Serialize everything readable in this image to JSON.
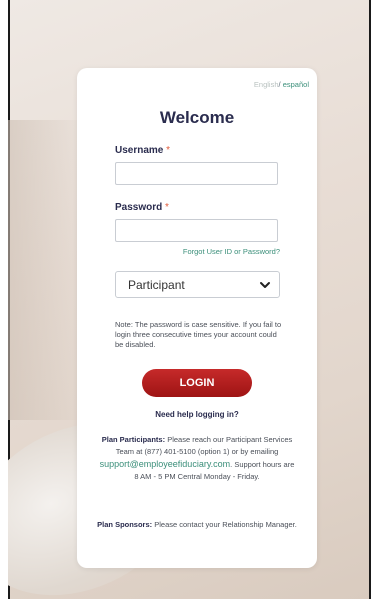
{
  "lang": {
    "english": "English",
    "separator": "/",
    "spanish": "español"
  },
  "title": "Welcome",
  "username": {
    "label": "Username",
    "required_mark": "*",
    "value": ""
  },
  "password": {
    "label": "Password",
    "required_mark": "*",
    "value": ""
  },
  "forgot_link": "Forgot User ID or Password?",
  "role_select": {
    "selected": "Participant"
  },
  "note": "Note: The password is case sensitive. If you fail to login three consecutive times your account could be disabled.",
  "login_button": "LOGIN",
  "help_heading": "Need help logging in?",
  "participants": {
    "heading": "Plan Participants:",
    "text_before": "Please reach our Participant Services Team at (877) 401-5100 (option 1) or by emailing",
    "email": "support@employeefiduciary.com",
    "text_after": ". Support hours are 8 AM - 5 PM Central Monday - Friday."
  },
  "sponsors": {
    "heading": "Plan Sponsors:",
    "text": "Please contact your Relationship Manager."
  },
  "colors": {
    "accent_red": "#b01e1e",
    "link_green": "#3b8f7a",
    "heading_navy": "#2a2c4e"
  }
}
